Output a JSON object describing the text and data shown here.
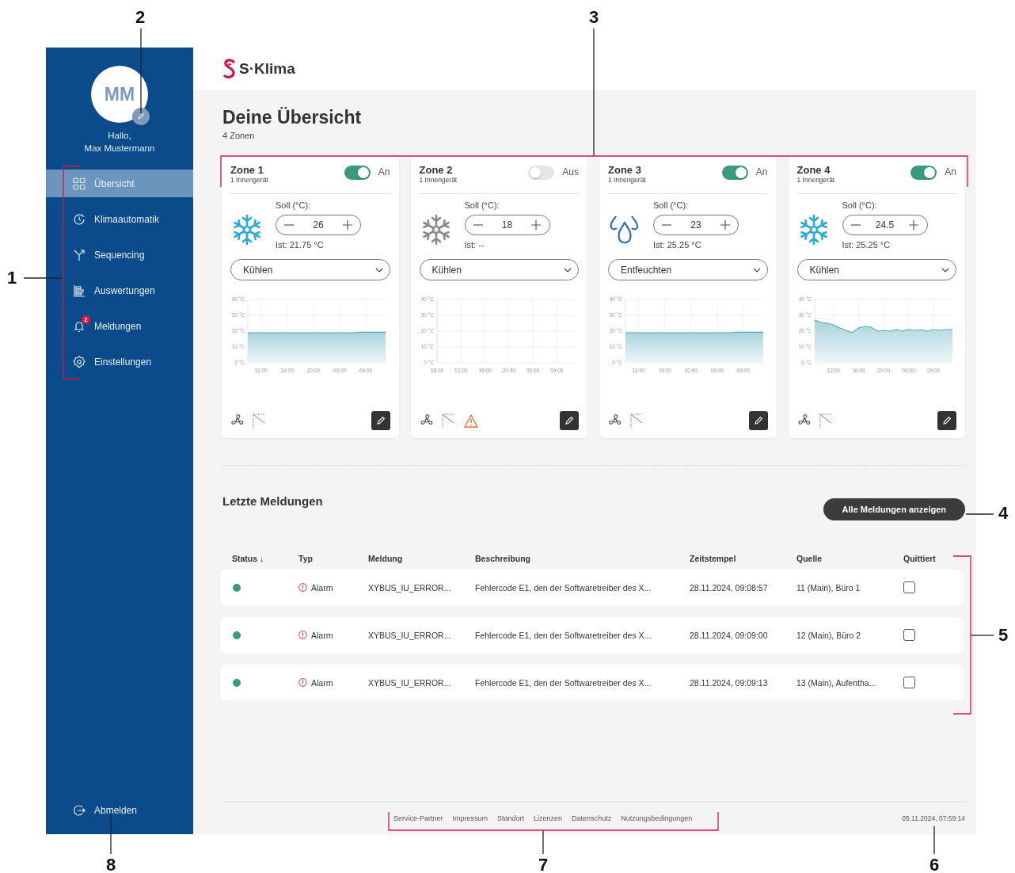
{
  "sidebar": {
    "avatar": {
      "initials": "MM"
    },
    "greeting": "Hallo,",
    "user_name": "Max Mustermann",
    "nav_items": [
      {
        "label": "Übersicht",
        "selected": true
      },
      {
        "label": "Klimaautomatik",
        "selected": false
      },
      {
        "label": "Sequencing",
        "selected": false
      },
      {
        "label": "Auswertungen",
        "selected": false
      },
      {
        "label": "Meldungen",
        "badge": "2",
        "selected": false
      },
      {
        "label": "Einstellungen",
        "selected": false
      }
    ],
    "logout": "Abmelden"
  },
  "header": {
    "logo_text": "S·Klima"
  },
  "page": {
    "title": "Deine Übersicht",
    "subtitle": "4 Zonen"
  },
  "zones": [
    {
      "name": "Zone 1",
      "devices": "1 Innengerät",
      "on": true,
      "power_label": "An",
      "kind": "snowflake",
      "setpoint_label": "Soll (°C):",
      "setpoint": "26",
      "actual": "Ist: 21.75 °C",
      "mode": "Kühlen",
      "warning": false,
      "chart_data": {
        "type": "area",
        "grid": true,
        "categories": [
          null,
          null,
          "12:00",
          null,
          null,
          null,
          "16:00",
          null,
          null,
          null,
          "20:00",
          null,
          null,
          null,
          "00:00",
          null,
          null,
          null,
          "04:00",
          null,
          null,
          null
        ],
        "ylim": [
          0,
          40
        ],
        "yticks": [
          {
            "value": 0,
            "label": "0 °C"
          },
          {
            "value": 10,
            "label": "10 °C"
          },
          {
            "value": 20,
            "label": "20 °C"
          },
          {
            "value": 30,
            "label": "30 °C"
          },
          {
            "value": 40,
            "label": "40 °C"
          }
        ],
        "series": [
          {
            "color": "#5ba7b5",
            "values": [
              19,
              19,
              19,
              19,
              19,
              19,
              19,
              19,
              19,
              19,
              19,
              19,
              19,
              19,
              19,
              19,
              19,
              19.3,
              19.3,
              19.3,
              19.3,
              19.3
            ]
          }
        ]
      }
    },
    {
      "name": "Zone 2",
      "devices": "1 Innengerät",
      "on": false,
      "power_label": "Aus",
      "kind": "snowflake",
      "setpoint_label": "Soll (°C):",
      "setpoint": "18",
      "actual": "Ist: --",
      "mode": "Kühlen",
      "warning": true,
      "chart_data": {
        "type": "area",
        "grid": true,
        "categories": [
          "08:00",
          null,
          null,
          null,
          "12:00",
          null,
          null,
          null,
          "16:00",
          null,
          null,
          null,
          "20:00",
          null,
          null,
          null,
          "00:00",
          null,
          null,
          null,
          "04:00",
          null,
          null,
          null
        ],
        "ylim": [
          0,
          40
        ],
        "yticks": [
          {
            "value": 0,
            "label": "0 °C"
          },
          {
            "value": 10,
            "label": "10 °C"
          },
          {
            "value": 20,
            "label": "20 °C"
          },
          {
            "value": 30,
            "label": "30 °C"
          },
          {
            "value": 40,
            "label": "40 °C"
          }
        ]
      }
    },
    {
      "name": "Zone 3",
      "devices": "1 Innengerät",
      "on": true,
      "power_label": "An",
      "kind": "drops",
      "setpoint_label": "Soll (°C):",
      "setpoint": "23",
      "actual": "Ist: 25.25 °C",
      "mode": "Entfeuchten",
      "warning": false,
      "chart_data": {
        "type": "area",
        "grid": true,
        "categories": [
          null,
          null,
          "12:00",
          null,
          null,
          null,
          "16:00",
          null,
          null,
          null,
          "20:00",
          null,
          null,
          null,
          "00:00",
          null,
          null,
          null,
          "04:00",
          null,
          null,
          null
        ],
        "ylim": [
          0,
          40
        ],
        "yticks": [
          {
            "value": 0,
            "label": "0 °C"
          },
          {
            "value": 10,
            "label": "10 °C"
          },
          {
            "value": 20,
            "label": "20 °C"
          },
          {
            "value": 30,
            "label": "30 °C"
          },
          {
            "value": 40,
            "label": "40 °C"
          }
        ],
        "series": [
          {
            "color": "#5ba7b5",
            "values": [
              19,
              19,
              19,
              19,
              19,
              19,
              19,
              19,
              19,
              19,
              19,
              19,
              19,
              19,
              19,
              19,
              19,
              19.3,
              19.3,
              19.3,
              19.3,
              19.3
            ]
          }
        ]
      }
    },
    {
      "name": "Zone 4",
      "devices": "1 Innengerät",
      "on": true,
      "power_label": "An",
      "kind": "snowflake",
      "setpoint_label": "Soll (°C):",
      "setpoint": "24.5",
      "actual": "Ist: 25.25 °C",
      "mode": "Kühlen",
      "warning": false,
      "chart_data": {
        "type": "area",
        "grid": true,
        "categories": [
          null,
          null,
          null,
          "12:00",
          null,
          null,
          null,
          "16:00",
          null,
          null,
          null,
          "20:00",
          null,
          null,
          null,
          "00:00",
          null,
          null,
          null,
          "04:00",
          null,
          null,
          null
        ],
        "ylim": [
          0,
          40
        ],
        "yticks": [
          {
            "value": 0,
            "label": "0 °C"
          },
          {
            "value": 10,
            "label": "10 °C"
          },
          {
            "value": 20,
            "label": "20 °C"
          },
          {
            "value": 30,
            "label": "30 °C"
          },
          {
            "value": 40,
            "label": "40 °C"
          }
        ],
        "series": [
          {
            "color": "#5ba7b5",
            "values": [
              27,
              25.5,
              25,
              24,
              22,
              20.5,
              19,
              22,
              23,
              22.5,
              20,
              20.5,
              20,
              21,
              20,
              21,
              20.5,
              21,
              20,
              21,
              20.5,
              21,
              21
            ]
          }
        ]
      }
    }
  ],
  "messages": {
    "title": "Letzte Meldungen",
    "button": "Alle Meldungen anzeigen",
    "columns": [
      "Status ↓",
      "Typ",
      "Meldung",
      "Beschreibung",
      "Zeitstempel",
      "Quelle",
      "Quittiert"
    ],
    "rows": [
      {
        "color": "#3a9a7f",
        "type": "Alarm",
        "message": "XYBUS_IU_ERROR...",
        "description": "Fehlercode E1, den der Softwaretreiber des X...",
        "timestamp": "28.11.2024, 09:08:57",
        "source": "11 (Main), Büro 1",
        "acknowledged": false
      },
      {
        "color": "#3a9a7f",
        "type": "Alarm",
        "message": "XYBUS_IU_ERROR...",
        "description": "Fehlercode E1, den der Softwaretreiber des X...",
        "timestamp": "28.11.2024, 09:09:00",
        "source": "12 (Main), Büro 2",
        "acknowledged": false
      },
      {
        "color": "#3a9a7f",
        "type": "Alarm",
        "message": "XYBUS_IU_ERROR...",
        "description": "Fehlercode E1, den der Softwaretreiber des X...",
        "timestamp": "28.11.2024, 09:09:13",
        "source": "13 (Main), Aufentha...",
        "acknowledged": false
      }
    ]
  },
  "footer": {
    "links": [
      "Service-Partner",
      "Impressum",
      "Standort",
      "Lizenzen",
      "Datenschutz",
      "Nutzungsbedingungen"
    ],
    "timestamp": "05.11.2024, 07:59:14"
  },
  "callouts": [
    "2",
    "3",
    "1",
    "4",
    "5",
    "8",
    "7",
    "6"
  ]
}
